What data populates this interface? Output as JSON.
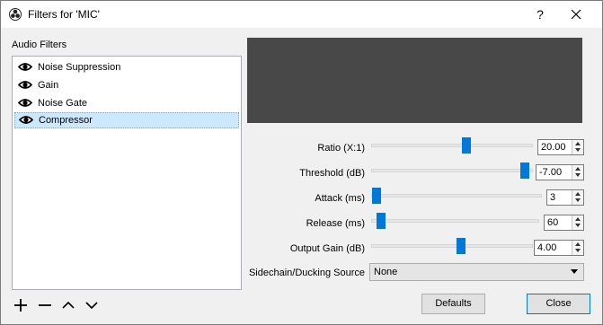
{
  "window": {
    "title": "Filters for 'MIC'",
    "help_label": "?"
  },
  "filters": {
    "section_label": "Audio Filters",
    "items": [
      {
        "label": "Noise Suppression",
        "selected": false
      },
      {
        "label": "Gain",
        "selected": false
      },
      {
        "label": "Noise Gate",
        "selected": false
      },
      {
        "label": "Compressor",
        "selected": true
      }
    ]
  },
  "params": {
    "ratio": {
      "label": "Ratio (X:1)",
      "value": "20.00",
      "slider_fraction": 0.59
    },
    "threshold": {
      "label": "Threshold (dB)",
      "value": "-7.00",
      "slider_fraction": 0.97
    },
    "attack": {
      "label": "Attack (ms)",
      "value": "3",
      "slider_fraction": 0.0
    },
    "release": {
      "label": "Release (ms)",
      "value": "60",
      "slider_fraction": 0.03
    },
    "output_gain": {
      "label": "Output Gain (dB)",
      "value": "4.00",
      "slider_fraction": 0.55
    },
    "sidechain": {
      "label": "Sidechain/Ducking Source",
      "value": "None"
    }
  },
  "buttons": {
    "defaults": "Defaults",
    "close": "Close"
  },
  "colors": {
    "accent": "#0078d7",
    "preview_bg": "#484848",
    "selection": "#cce8ff"
  }
}
